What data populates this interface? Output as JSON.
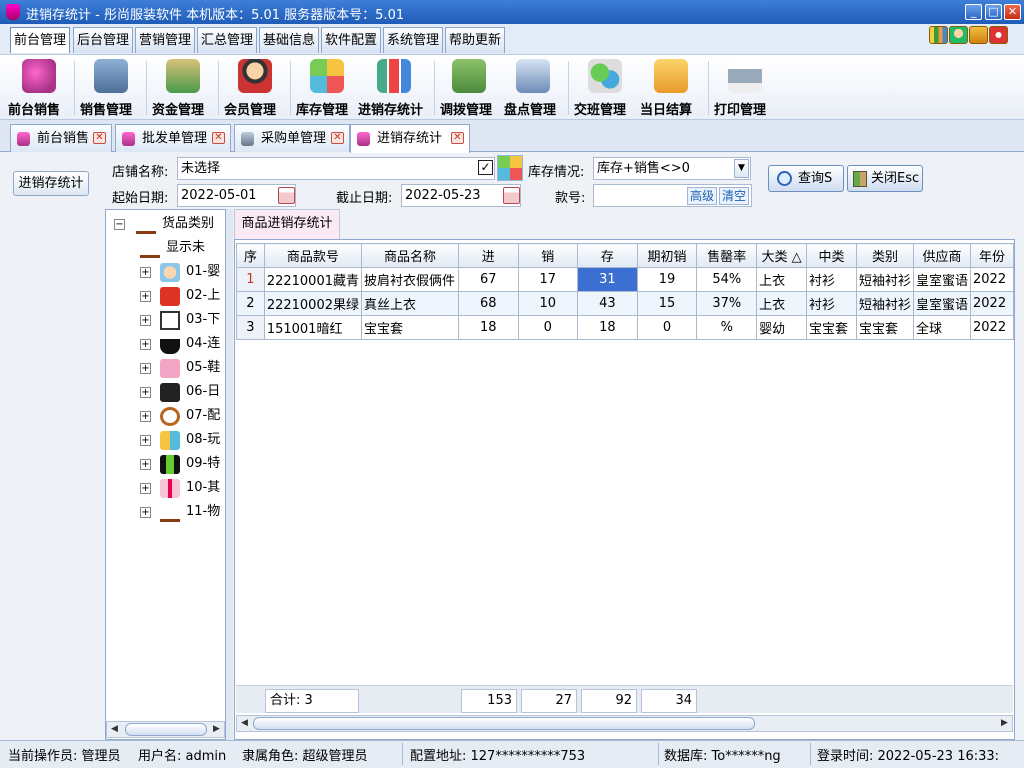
{
  "window": {
    "title": "进销存统计 - 彤尚服装软件 本机版本：5.01 服务器版本号：5.01"
  },
  "menu": [
    {
      "label": "前台管理"
    },
    {
      "label": "后台管理"
    },
    {
      "label": "营销管理"
    },
    {
      "label": "汇总管理"
    },
    {
      "label": "基础信息"
    },
    {
      "label": "软件配置"
    },
    {
      "label": "系统管理"
    },
    {
      "label": "帮助更新"
    }
  ],
  "ribbon": [
    {
      "label": "前台销售",
      "icon": "shopping-bags-icon"
    },
    {
      "label": "销售管理",
      "icon": "cash-register-icon"
    },
    {
      "label": "资金管理",
      "icon": "money-icon"
    },
    {
      "label": "会员管理",
      "icon": "member-icon"
    },
    {
      "label": "库存管理",
      "icon": "inventory-icon"
    },
    {
      "label": "进销存统计",
      "icon": "bar-chart-icon"
    },
    {
      "label": "调拨管理",
      "icon": "transfer-icon"
    },
    {
      "label": "盘点管理",
      "icon": "stocktake-icon"
    },
    {
      "label": "交班管理",
      "icon": "shift-handover-icon"
    },
    {
      "label": "当日结算",
      "icon": "daily-settlement-icon"
    },
    {
      "label": "打印管理",
      "icon": "printer-icon"
    }
  ],
  "doc_tabs": [
    {
      "label": "前台销售"
    },
    {
      "label": "批发单管理"
    },
    {
      "label": "采购单管理"
    },
    {
      "label": "进销存统计"
    }
  ],
  "filters": {
    "side_button": "进销存统计",
    "store_label": "店铺名称:",
    "store_value": "未选择",
    "stock_label": "库存情况:",
    "stock_value": "库存+销售<>0",
    "start_label": "起始日期:",
    "start_value": "2022-05-01",
    "end_label": "截止日期:",
    "end_value": "2022-05-23",
    "sku_label": "款号:",
    "sku_value": "",
    "advanced": "高级",
    "clear": "清空",
    "query": "查询S",
    "close": "关闭Esc"
  },
  "tree": {
    "root": "货品类别",
    "items": [
      {
        "label": "显示未"
      },
      {
        "label": "01-婴"
      },
      {
        "label": "02-上"
      },
      {
        "label": "03-下"
      },
      {
        "label": "04-连"
      },
      {
        "label": "05-鞋"
      },
      {
        "label": "06-日"
      },
      {
        "label": "07-配"
      },
      {
        "label": "08-玩"
      },
      {
        "label": "09-特"
      },
      {
        "label": "10-其"
      },
      {
        "label": "11-物"
      }
    ]
  },
  "grid": {
    "tab": "商品进销存统计",
    "columns": [
      "序",
      "商品款号",
      "商品名称",
      "进",
      "销",
      "存",
      "期初销",
      "售罄率",
      "大类 △",
      "中类",
      "类别",
      "供应商",
      "年份"
    ],
    "rows": [
      [
        "1",
        "22210001藏青",
        "披肩衬衣假俩件",
        "67",
        "17",
        "31",
        "19",
        "54%",
        "上衣",
        "衬衫",
        "短袖衬衫",
        "皇室蜜语",
        "2022"
      ],
      [
        "2",
        "22210002果绿",
        "真丝上衣",
        "68",
        "10",
        "43",
        "15",
        "37%",
        "上衣",
        "衬衫",
        "短袖衬衫",
        "皇室蜜语",
        "2022"
      ],
      [
        "3",
        "151001暗红",
        "宝宝套",
        "18",
        "0",
        "18",
        "0",
        "%",
        "婴幼",
        "宝宝套",
        "宝宝套",
        "全球",
        "2022"
      ]
    ],
    "footer": {
      "total": "合计: 3",
      "in": "153",
      "out": "27",
      "stock": "92",
      "opening": "34"
    }
  },
  "status": {
    "operator": "当前操作员: 管理员",
    "user": "用户名: admin",
    "role": "隶属角色: 超级管理员",
    "server": "配置地址: 127**********753",
    "db": "数据库: To******ng",
    "login": "登录时间: 2022-05-23 16:33:"
  }
}
